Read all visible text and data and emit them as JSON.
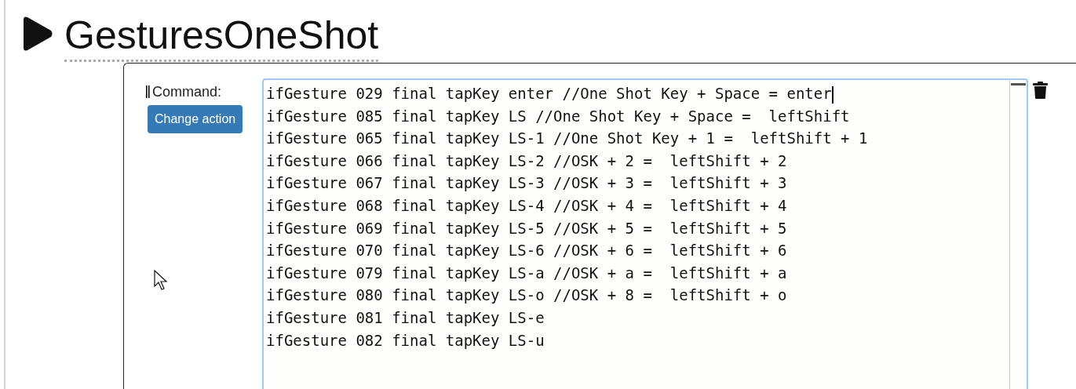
{
  "title": "GesturesOneShot",
  "command": {
    "label": "Command:",
    "button": "Change action",
    "lines": [
      "ifGesture 029 final tapKey enter //One Shot Key + Space = enter",
      "ifGesture 085 final tapKey LS //One Shot Key + Space =  leftShift",
      "ifGesture 065 final tapKey LS-1 //One Shot Key + 1 =  leftShift + 1",
      "ifGesture 066 final tapKey LS-2 //OSK + 2 =  leftShift + 2",
      "ifGesture 067 final tapKey LS-3 //OSK + 3 =  leftShift + 3",
      "ifGesture 068 final tapKey LS-4 //OSK + 4 =  leftShift + 4",
      "ifGesture 069 final tapKey LS-5 //OSK + 5 =  leftShift + 5",
      "ifGesture 070 final tapKey LS-6 //OSK + 6 =  leftShift + 6",
      "ifGesture 079 final tapKey LS-a //OSK + a =  leftShift + a",
      "ifGesture 080 final tapKey LS-o //OSK + 8 =  leftShift + o",
      "ifGesture 081 final tapKey LS-e",
      "ifGesture 082 final tapKey LS-u"
    ]
  }
}
